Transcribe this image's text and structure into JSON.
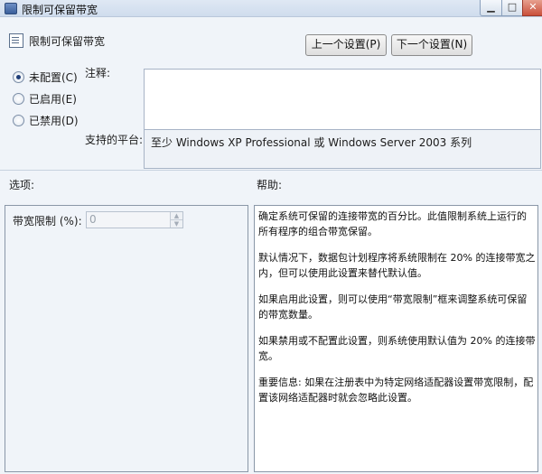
{
  "window": {
    "title": "限制可保留带宽"
  },
  "header": {
    "title": "限制可保留带宽",
    "prev_label": "上一个设置(P)",
    "next_label": "下一个设置(N)"
  },
  "state": {
    "options": [
      {
        "label": "未配置(C)",
        "checked": true
      },
      {
        "label": "已启用(E)",
        "checked": false
      },
      {
        "label": "已禁用(D)",
        "checked": false
      }
    ]
  },
  "comment": {
    "label": "注释:",
    "value": ""
  },
  "platform": {
    "label": "支持的平台:",
    "value": "至少 Windows XP Professional 或 Windows Server 2003 系列"
  },
  "options_pane": {
    "label": "选项:",
    "bandwidth_label": "带宽限制 (%):",
    "bandwidth_value": "0"
  },
  "help_pane": {
    "label": "帮助:",
    "paragraphs": [
      "确定系统可保留的连接带宽的百分比。此值限制系统上运行的所有程序的组合带宽保留。",
      "默认情况下，数据包计划程序将系统限制在 20% 的连接带宽之内，但可以使用此设置来替代默认值。",
      "如果启用此设置，则可以使用“带宽限制”框来调整系统可保留的带宽数量。",
      "如果禁用或不配置此设置，则系统使用默认值为 20% 的连接带宽。",
      "重要信息: 如果在注册表中为特定网络适配器设置带宽限制，配置该网络适配器时就会忽略此设置。"
    ]
  }
}
